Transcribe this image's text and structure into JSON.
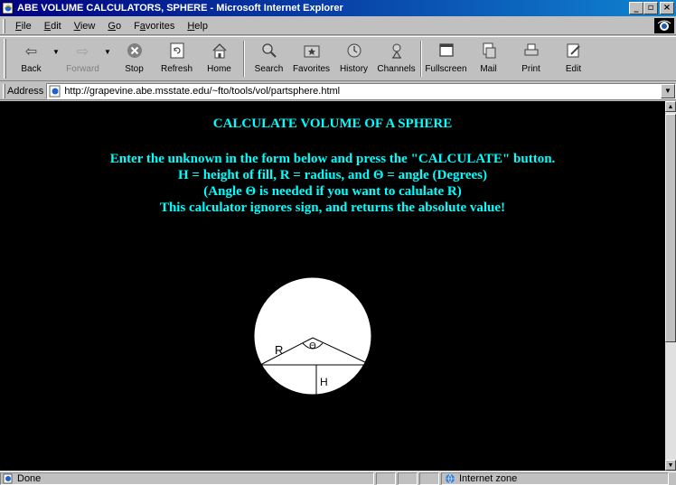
{
  "window": {
    "title": "ABE VOLUME CALCULATORS, SPHERE - Microsoft Internet Explorer",
    "controls": {
      "minimize": "_",
      "maximize": "▫",
      "close": "×"
    }
  },
  "menu": {
    "items": [
      {
        "key": "F",
        "rest": "ile"
      },
      {
        "key": "E",
        "rest": "dit"
      },
      {
        "key": "V",
        "rest": "iew"
      },
      {
        "key": "G",
        "rest": "o"
      },
      {
        "key": "",
        "pre": "F",
        "rest": "avorites",
        "alt": "a"
      },
      {
        "key": "H",
        "rest": "elp"
      }
    ]
  },
  "toolbar": {
    "back": "Back",
    "forward": "Forward",
    "stop": "Stop",
    "refresh": "Refresh",
    "home": "Home",
    "search": "Search",
    "favorites": "Favorites",
    "history": "History",
    "channels": "Channels",
    "fullscreen": "Fullscreen",
    "mail": "Mail",
    "print": "Print",
    "edit": "Edit"
  },
  "address": {
    "label": "Address",
    "url": "http://grapevine.abe.msstate.edu/~fto/tools/vol/partsphere.html"
  },
  "page": {
    "heading": "CALCULATE VOLUME OF A SPHERE",
    "line1": "Enter the unknown in the form below and press the \"CALCULATE\" button.",
    "line2": "H = height of fill, R = radius, and Θ = angle (Degrees)",
    "line3": "(Angle Θ is needed if you want to calulate R)",
    "line4": "This calculator ignores sign, and returns the absolute value!",
    "diagram": {
      "r_label": "R",
      "theta_label": "Θ",
      "h_label": "H"
    }
  },
  "status": {
    "text": "Done",
    "zone": "Internet zone"
  },
  "colors": {
    "content_bg": "#000000",
    "heading_text": "#00ffff",
    "titlebar": "#000080"
  }
}
